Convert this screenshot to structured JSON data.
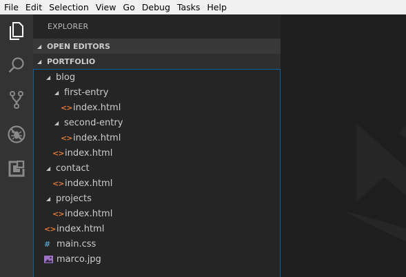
{
  "menu": [
    "File",
    "Edit",
    "Selection",
    "View",
    "Go",
    "Debug",
    "Tasks",
    "Help"
  ],
  "activity": [
    {
      "icon": "files-icon"
    },
    {
      "icon": "search-icon"
    },
    {
      "icon": "source-control-icon"
    },
    {
      "icon": "debug-icon"
    },
    {
      "icon": "extensions-icon"
    }
  ],
  "explorer": {
    "title": "EXPLORER",
    "open_editors": "OPEN EDITORS",
    "folder": "PORTFOLIO"
  },
  "tree": [
    {
      "label": "blog",
      "type": "folder",
      "depth": 1
    },
    {
      "label": "first-entry",
      "type": "folder",
      "depth": 2
    },
    {
      "label": "index.html",
      "type": "html",
      "depth": 3
    },
    {
      "label": "second-entry",
      "type": "folder",
      "depth": 2
    },
    {
      "label": "index.html",
      "type": "html",
      "depth": 3
    },
    {
      "label": "index.html",
      "type": "html",
      "depth": 2
    },
    {
      "label": "contact",
      "type": "folder",
      "depth": 1
    },
    {
      "label": "index.html",
      "type": "html",
      "depth": 2
    },
    {
      "label": "projects",
      "type": "folder",
      "depth": 1
    },
    {
      "label": "index.html",
      "type": "html",
      "depth": 2
    },
    {
      "label": "index.html",
      "type": "html",
      "depth": 1
    },
    {
      "label": "main.css",
      "type": "css",
      "depth": 1
    },
    {
      "label": "marco.jpg",
      "type": "image",
      "depth": 1
    }
  ],
  "colors": {
    "activity_bar": "#333333",
    "sidebar": "#252526",
    "editor": "#1e1e1e",
    "html_icon": "#e37933",
    "css_icon": "#519aba",
    "image_icon": "#a074c4",
    "focus_border": "#0e639c"
  }
}
